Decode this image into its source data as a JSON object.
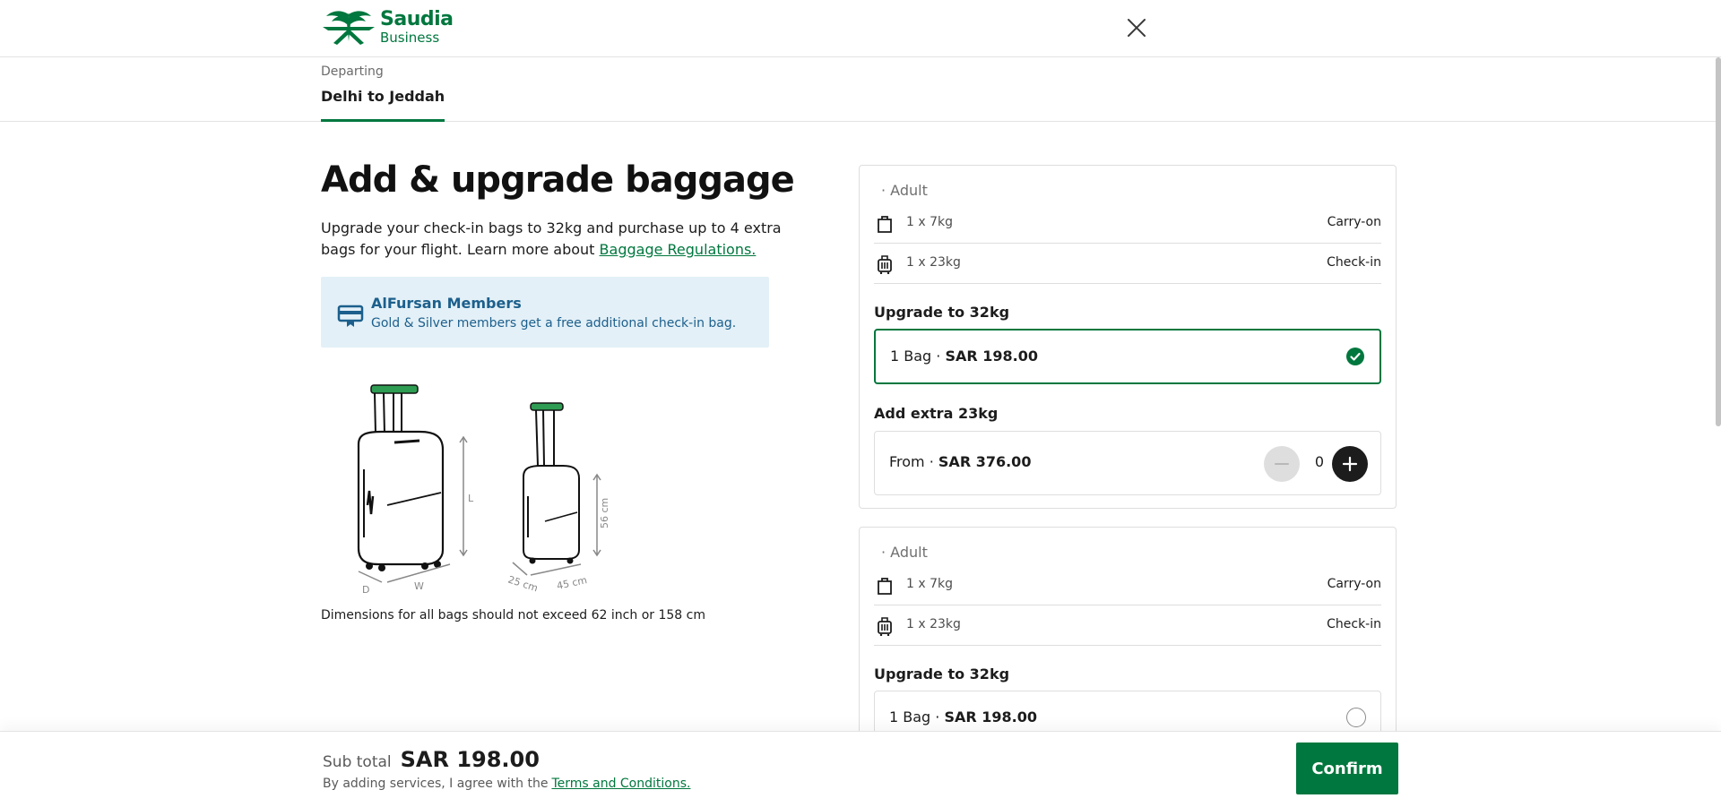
{
  "brand": {
    "name": "Saudia",
    "tier": "Business",
    "color": "#00773e"
  },
  "header": {
    "close_icon": "close-icon"
  },
  "tab": {
    "sub": "Departing",
    "route": "Delhi to Jeddah"
  },
  "page": {
    "title": "Add & upgrade baggage",
    "intro_text": "Upgrade your check-in bags to 32kg and purchase up to 4 extra bags for your flight. Learn more about ",
    "intro_link": "Baggage Regulations.",
    "member_title": "AlFursan Members",
    "member_desc": "Gold & Silver members get a free additional check-in bag.",
    "dims_note": "Dimensions for all bags should not exceed 62 inch or 158 cm",
    "luggage_labels": {
      "height_large": "L",
      "depth_large": "D",
      "width_large": "W",
      "height_small": "56 cm",
      "depth_small": "25 cm",
      "width_small": "45 cm"
    }
  },
  "passengers": [
    {
      "label": "· Adult",
      "bags": [
        {
          "weight": "1 x 7kg",
          "type": "Carry-on",
          "icon": "carry-on-bag-icon"
        },
        {
          "weight": "1 x 23kg",
          "type": "Check-in",
          "icon": "check-in-bag-icon"
        }
      ],
      "upgrade_label": "Upgrade to 32kg",
      "upgrade_prefix": "1 Bag · ",
      "upgrade_price": "SAR 198.00",
      "upgrade_selected": true,
      "extra_label": "Add extra 23kg",
      "extra_prefix": "From · ",
      "extra_price": "SAR 376.00",
      "extra_count": "0"
    },
    {
      "label": "· Adult",
      "bags": [
        {
          "weight": "1 x 7kg",
          "type": "Carry-on",
          "icon": "carry-on-bag-icon"
        },
        {
          "weight": "1 x 23kg",
          "type": "Check-in",
          "icon": "check-in-bag-icon"
        }
      ],
      "upgrade_label": "Upgrade to 32kg",
      "upgrade_prefix": "1 Bag · ",
      "upgrade_price": "SAR 198.00",
      "upgrade_selected": false
    }
  ],
  "footer": {
    "subtotal_label": "Sub total",
    "subtotal_value": "SAR 198.00",
    "terms_text": "By adding services, I agree with the",
    "terms_link": "Terms and Conditions.",
    "confirm_label": "Confirm"
  }
}
